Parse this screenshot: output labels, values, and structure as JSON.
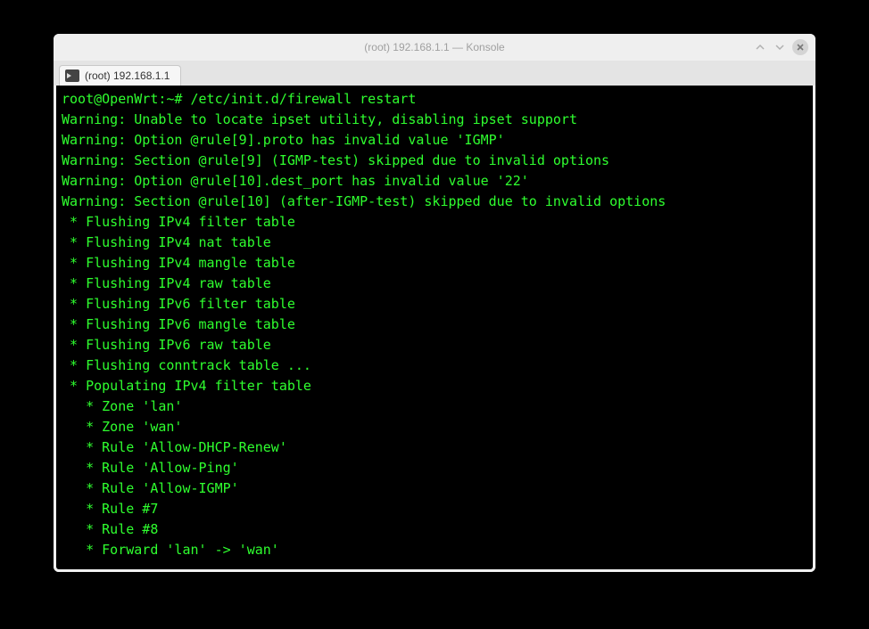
{
  "window": {
    "title": "(root) 192.168.1.1 — Konsole"
  },
  "tab": {
    "label": "(root) 192.168.1.1"
  },
  "prompt": {
    "text": "root@OpenWrt:~# ",
    "command": "/etc/init.d/firewall restart"
  },
  "lines": [
    "Warning: Unable to locate ipset utility, disabling ipset support",
    "Warning: Option @rule[9].proto has invalid value 'IGMP'",
    "Warning: Section @rule[9] (IGMP-test) skipped due to invalid options",
    "Warning: Option @rule[10].dest_port has invalid value '22'",
    "Warning: Section @rule[10] (after-IGMP-test) skipped due to invalid options",
    " * Flushing IPv4 filter table",
    " * Flushing IPv4 nat table",
    " * Flushing IPv4 mangle table",
    " * Flushing IPv4 raw table",
    " * Flushing IPv6 filter table",
    " * Flushing IPv6 mangle table",
    " * Flushing IPv6 raw table",
    " * Flushing conntrack table ...",
    " * Populating IPv4 filter table",
    "   * Zone 'lan'",
    "   * Zone 'wan'",
    "   * Rule 'Allow-DHCP-Renew'",
    "   * Rule 'Allow-Ping'",
    "   * Rule 'Allow-IGMP'",
    "   * Rule #7",
    "   * Rule #8",
    "   * Forward 'lan' -> 'wan'"
  ]
}
